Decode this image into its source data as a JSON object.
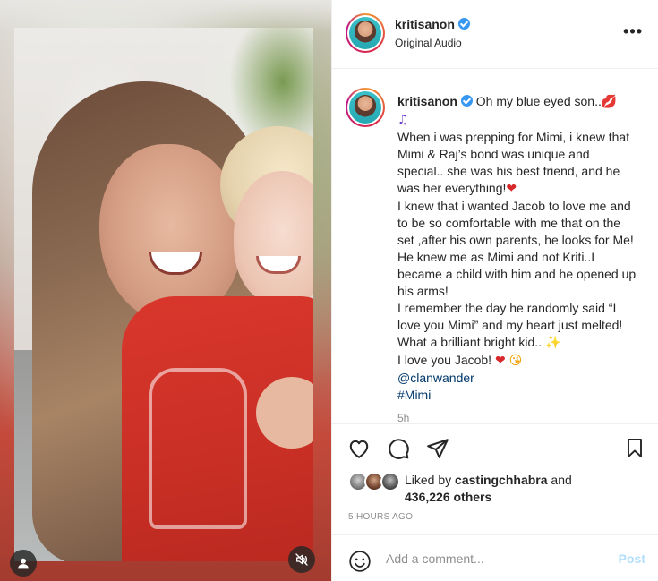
{
  "post": {
    "username": "kritisanon",
    "audio": "Original Audio",
    "more_label": "•••"
  },
  "caption": {
    "username": "kritisanon",
    "intro": "Oh my blue eyed son..",
    "body": "When i was prepping for Mimi, i knew that Mimi & Raj’s bond was unique and special.. she was his best friend, and he was her everything!",
    "body2": "I knew that i wanted Jacob to love me and to be so comfortable with me that on the set ,after his own parents, he looks for Me! He knew me as Mimi and not Kriti..I became a child with him and he opened up his arms!",
    "body3": "I remember the day he randomly said “I love you Mimi” and my heart just melted! What a brilliant bright kid..",
    "body4": "I love you Jacob!",
    "mention": "@clanwander",
    "hashtag": "#Mimi",
    "time_ago": "5h"
  },
  "likes": {
    "prefix": "Liked by",
    "user": "castingchhabra",
    "and": "and",
    "count": "436,226 others"
  },
  "post_time": "5 HOURS AGO",
  "comment": {
    "placeholder": "Add a comment...",
    "post_label": "Post"
  },
  "icons": {
    "like": "heart-outline-icon",
    "comment": "speech-bubble-icon",
    "share": "paper-plane-icon",
    "save": "bookmark-icon",
    "emoji": "smiley-icon",
    "user": "person-icon",
    "mute": "speaker-muted-icon"
  },
  "colors": {
    "verified": "#3897f0",
    "link": "#00376b",
    "post_disabled": "#b2dffc",
    "muted_text": "#8e8e8e"
  }
}
